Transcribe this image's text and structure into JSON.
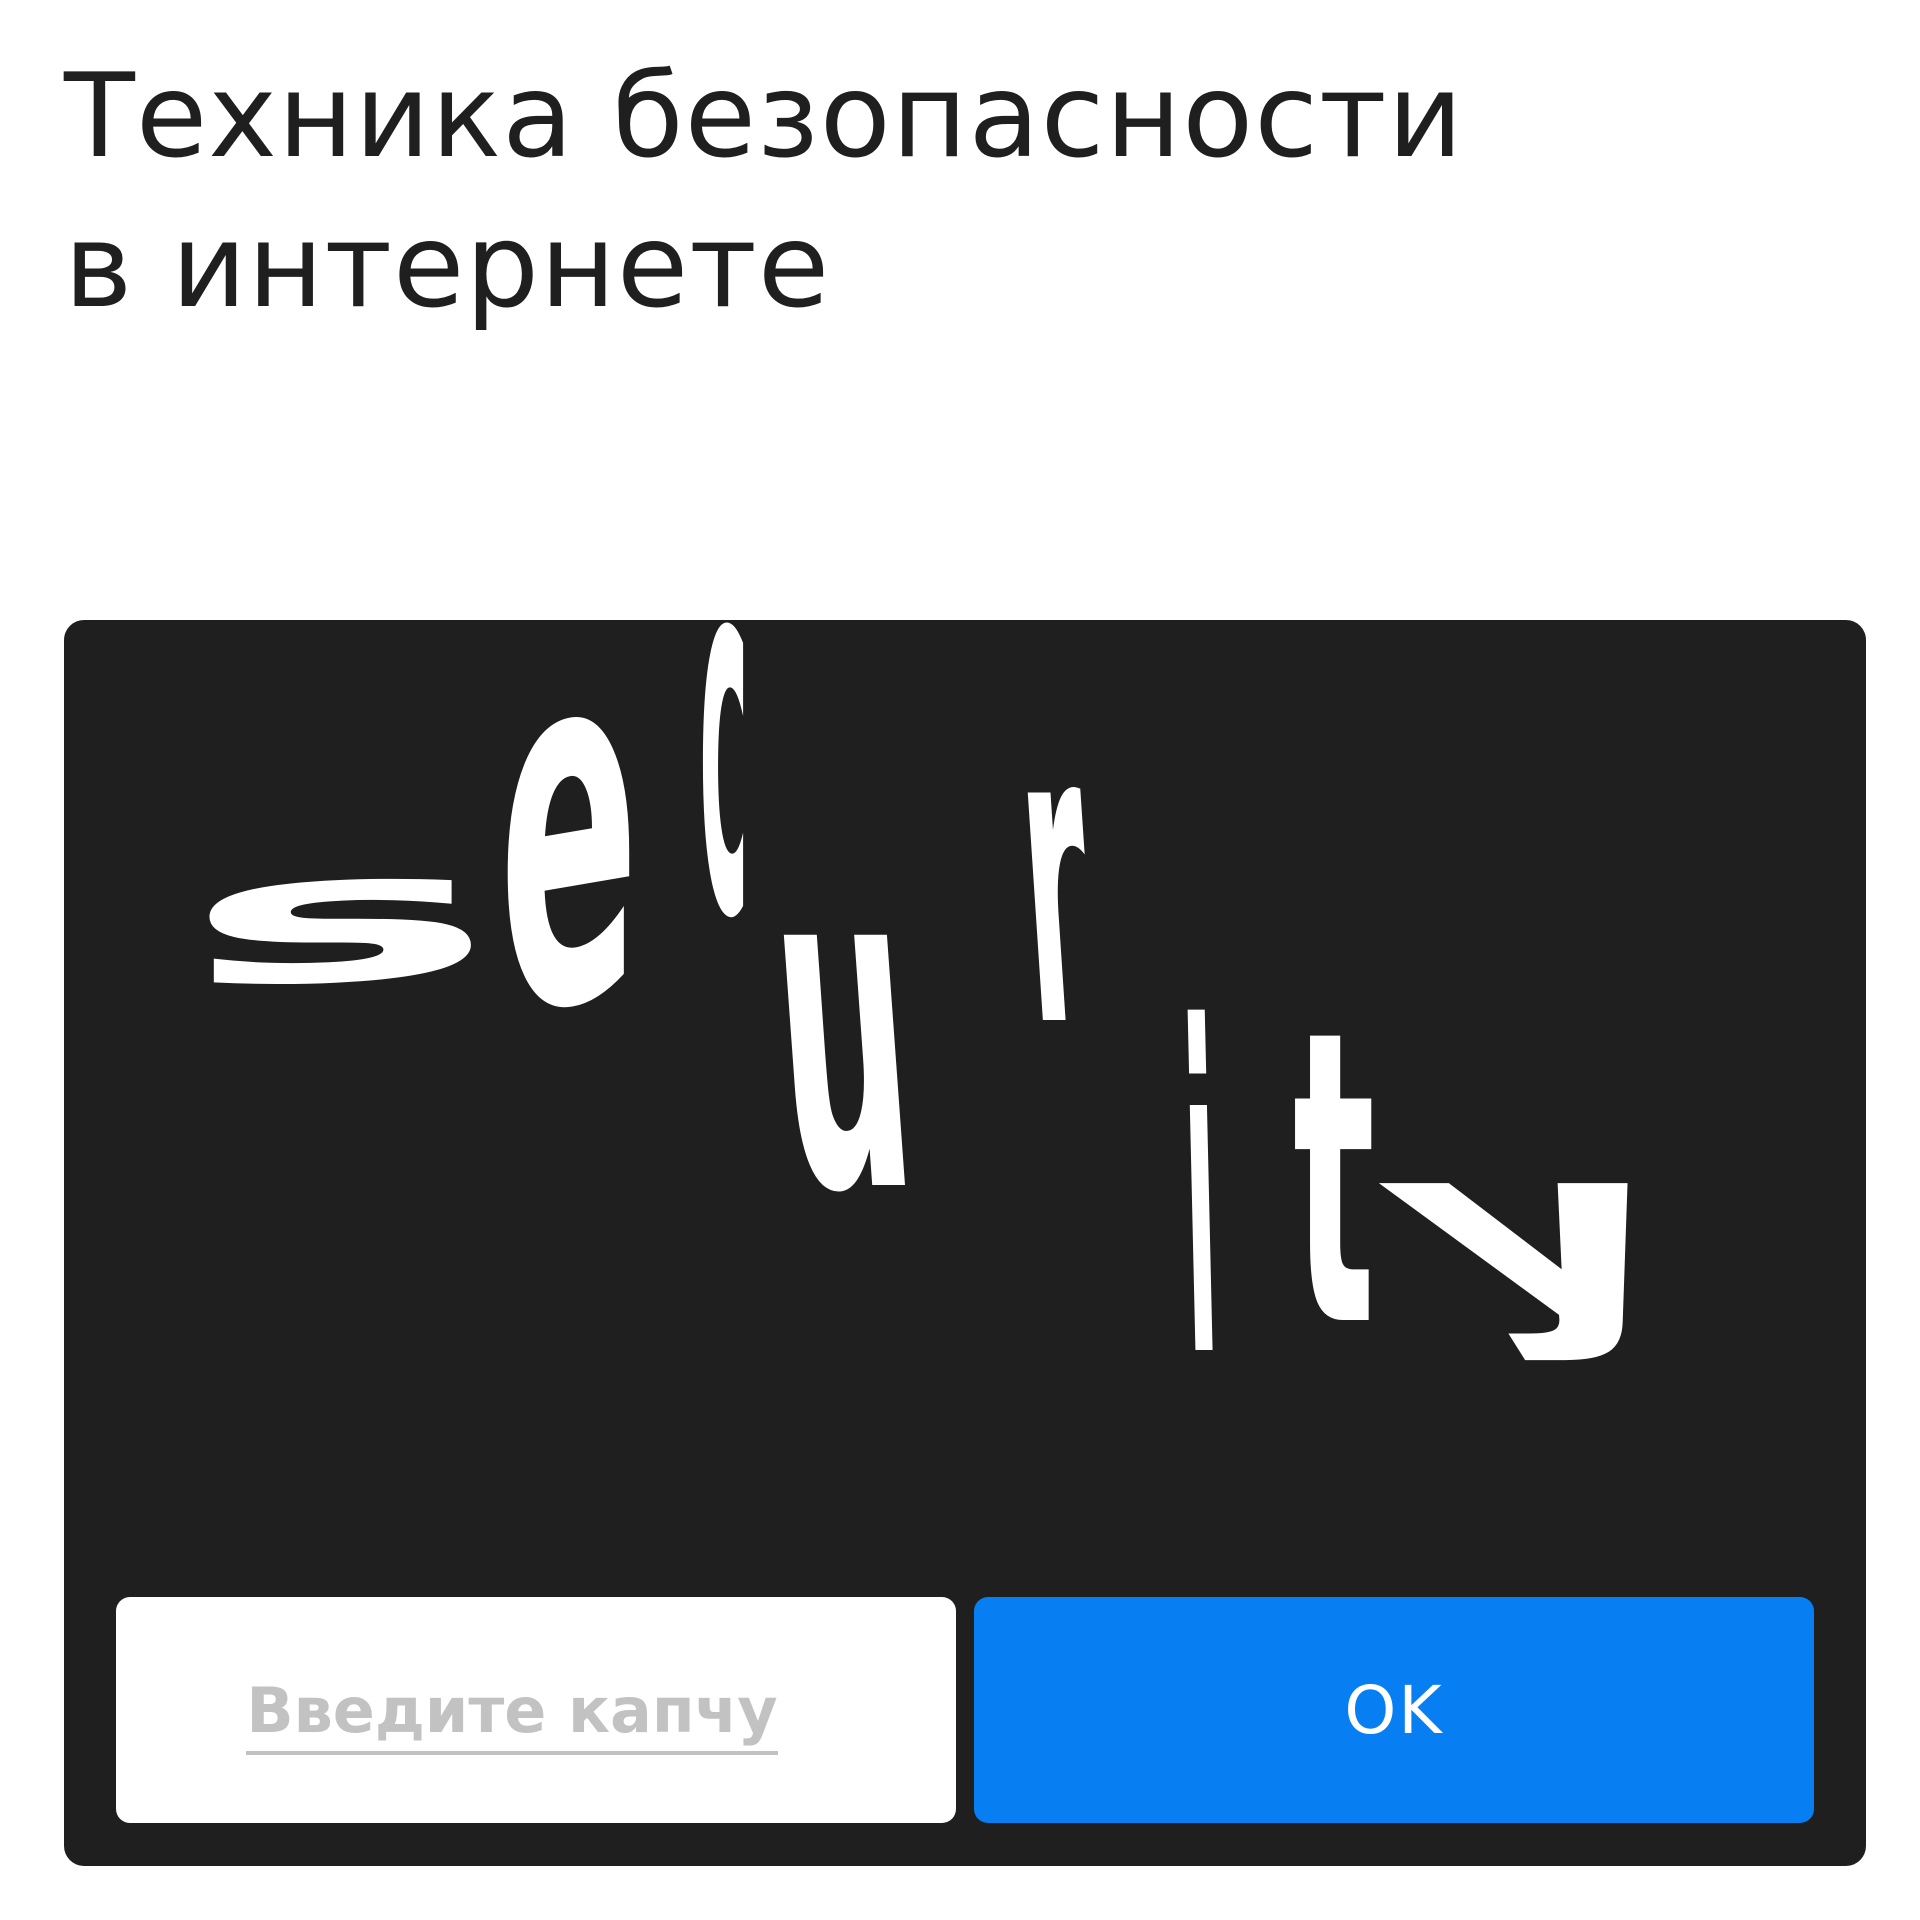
{
  "title": {
    "line1": "Техника безопасности",
    "line2": "в интернете"
  },
  "captcha": {
    "distorted_text": "security",
    "letters": [
      "s",
      "e",
      "c",
      "u",
      "r",
      "i",
      "t",
      "y"
    ],
    "input_placeholder": "Введите капчу",
    "ok_label": "OK"
  },
  "colors": {
    "panel_background": "#1f1f1f",
    "captcha_text": "#ffffff",
    "ok_button": "#077ef2",
    "placeholder": "#c2c2c2",
    "title_text": "#1f1f1f"
  }
}
